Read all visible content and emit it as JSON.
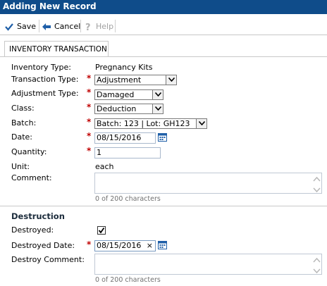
{
  "window": {
    "title": "Adding New Record"
  },
  "toolbar": {
    "save": "Save",
    "cancel": "Cancel",
    "help": "Help"
  },
  "tab": {
    "label": "INVENTORY TRANSACTION"
  },
  "form": {
    "inventory_type": {
      "label": "Inventory Type:",
      "value": "Pregnancy Kits"
    },
    "transaction_type": {
      "label": "Transaction Type:",
      "value": "Adjustment"
    },
    "adjustment_type": {
      "label": "Adjustment Type:",
      "value": "Damaged"
    },
    "class": {
      "label": "Class:",
      "value": "Deduction"
    },
    "batch": {
      "label": "Batch:",
      "value": "Batch: 123 | Lot: GH123"
    },
    "date": {
      "label": "Date:",
      "value": "08/15/2016"
    },
    "quantity": {
      "label": "Quantity:",
      "value": "1"
    },
    "unit": {
      "label": "Unit:",
      "value": "each"
    },
    "comment": {
      "label": "Comment:",
      "value": "",
      "hint": "0 of 200 characters"
    }
  },
  "destruction": {
    "title": "Destruction",
    "destroyed": {
      "label": "Destroyed:",
      "checked": true
    },
    "destroyed_date": {
      "label": "Destroyed Date:",
      "value": "08/15/2016",
      "clear": "×"
    },
    "destroy_comment": {
      "label": "Destroy Comment:",
      "value": "",
      "hint": "0 of 200 characters"
    }
  },
  "required_marker": "*",
  "colors": {
    "title_bar": "#0f4c8a",
    "required": "#c00000",
    "accent_icon": "#1f5fa8"
  }
}
